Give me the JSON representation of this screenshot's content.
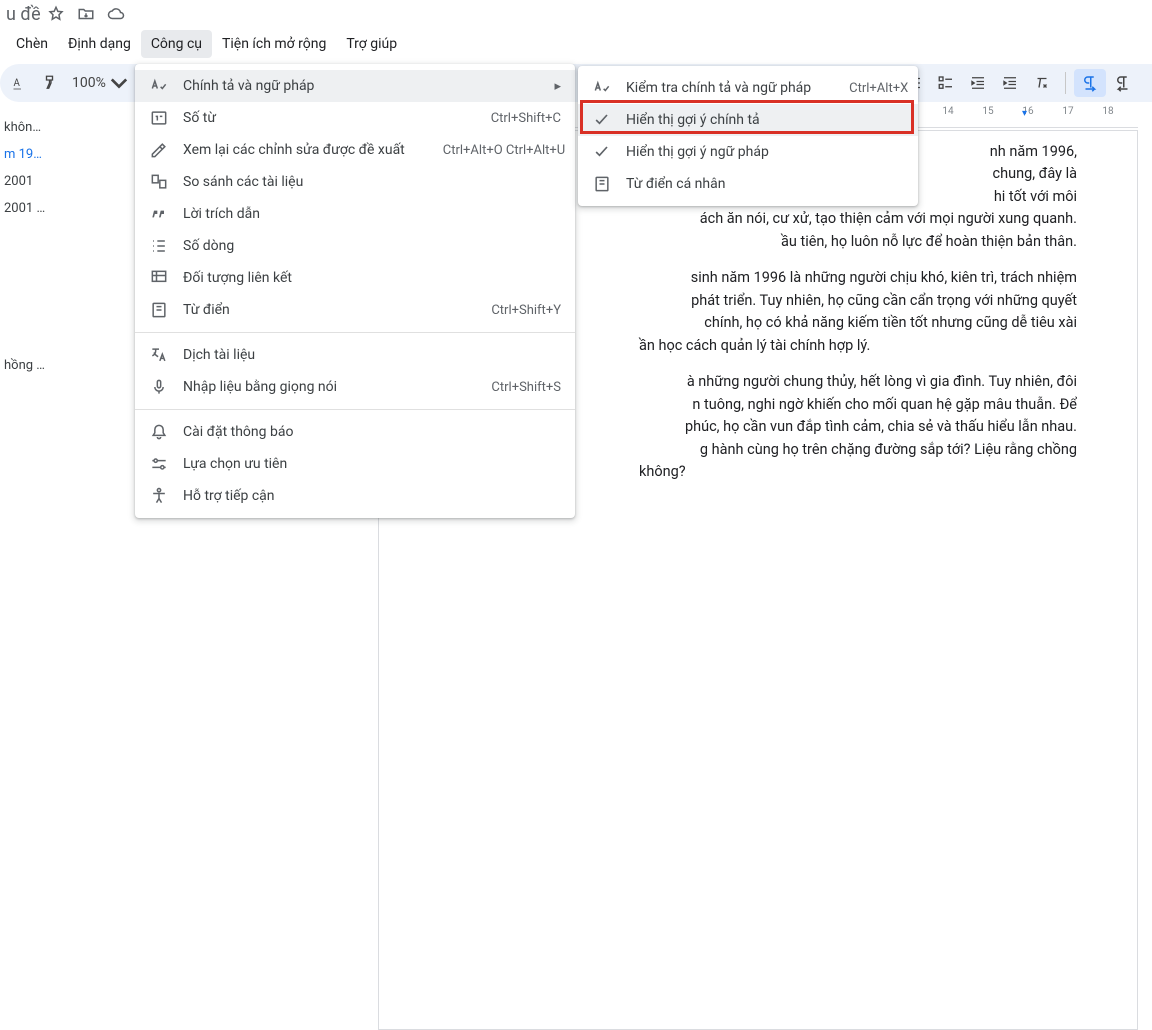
{
  "titlebar": {
    "title_suffix": "u đề"
  },
  "menubar": {
    "insert": "Chèn",
    "format": "Định dạng",
    "tools": "Công cụ",
    "extensions": "Tiện ích mở rộng",
    "help": "Trợ giúp"
  },
  "toolbar": {
    "zoom": "100%"
  },
  "ruler": {
    "labels": [
      "14",
      "15",
      "16",
      "17",
      "18"
    ]
  },
  "outline": {
    "i0": "khôn…",
    "i1": "m 19…",
    "i2": "2001",
    "i3": "2001 …",
    "i4": "hồng …"
  },
  "tools_menu": {
    "spelling": "Chính tả và ngữ pháp",
    "wordcount": "Số từ",
    "wordcount_sc": "Ctrl+Shift+C",
    "review": "Xem lại các chỉnh sửa được đề xuất",
    "review_sc": "Ctrl+Alt+O Ctrl+Alt+U",
    "compare": "So sánh các tài liệu",
    "citations": "Lời trích dẫn",
    "linecount": "Số dòng",
    "linked": "Đối tượng liên kết",
    "dict": "Từ điển",
    "dict_sc": "Ctrl+Shift+Y",
    "translate": "Dịch tài liệu",
    "voice": "Nhập liệu bằng giọng nói",
    "voice_sc": "Ctrl+Shift+S",
    "notif": "Cài đặt thông báo",
    "prefs": "Lựa chọn ưu tiên",
    "access": "Hỗ trợ tiếp cận"
  },
  "submenu": {
    "check": "Kiểm tra chính tả và ngữ pháp",
    "check_sc": "Ctrl+Alt+X",
    "showsp": "Hiển thị gợi ý chính tả",
    "showgr": "Hiển thị gợi ý ngữ pháp",
    "personal": "Từ điển cá nhân"
  },
  "doc": {
    "p1a": "nh năm 1996,",
    "p1b": "chung, đây là",
    "p1c": "hi tốt với môi",
    "p1d": "ách ăn nói, cư xử, tạo thiện cảm với mọi người xung quanh.",
    "p1e": "ầu tiên, họ luôn nỗ lực để hoàn thiện bản thân.",
    "p2a": "sinh năm 1996 là những người chịu khó, kiên trì, trách nhiệm",
    "p2b": "phát triển. Tuy nhiên, họ cũng cần cẩn trọng với những quyết",
    "p2c": "chính, họ có khả năng kiếm tiền tốt nhưng cũng dễ tiêu xài",
    "p2d": "ần học cách quản lý tài chính hợp lý.",
    "p3a": "à những người chung thủy, hết lòng vì gia đình. Tuy nhiên, đôi",
    "p3b": "n tuông, nghi ngờ khiến cho mối quan hệ gặp mâu thuẫn. Để",
    "p3c": "phúc, họ cần vun đắp tình cảm, chia sẻ và thấu hiểu lẫn nhau.",
    "p3d": "g hành cùng họ trên chặng đường sắp tới? Liệu rằng chồng",
    "p3e": "không?"
  }
}
